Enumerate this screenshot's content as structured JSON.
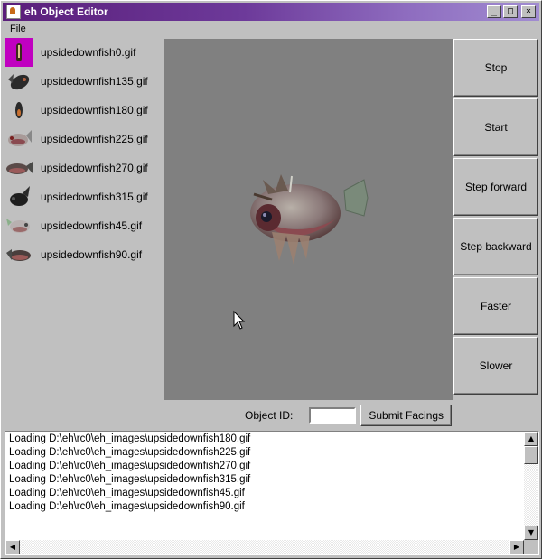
{
  "window": {
    "title": "eh Object Editor",
    "controls": {
      "minimize": "_",
      "maximize": "□",
      "close": "×"
    }
  },
  "menu": {
    "file": "File"
  },
  "files": [
    {
      "name": "upsidedownfish0.gif",
      "selected": true
    },
    {
      "name": "upsidedownfish135.gif",
      "selected": false
    },
    {
      "name": "upsidedownfish180.gif",
      "selected": false
    },
    {
      "name": "upsidedownfish225.gif",
      "selected": false
    },
    {
      "name": "upsidedownfish270.gif",
      "selected": false
    },
    {
      "name": "upsidedownfish315.gif",
      "selected": false
    },
    {
      "name": "upsidedownfish45.gif",
      "selected": false
    },
    {
      "name": "upsidedownfish90.gif",
      "selected": false
    }
  ],
  "controls": {
    "stop": "Stop",
    "start": "Start",
    "step_forward": "Step forward",
    "step_backward": "Step backward",
    "faster": "Faster",
    "slower": "Slower"
  },
  "object_id": {
    "label": "Object ID:",
    "value": "",
    "submit": "Submit Facings"
  },
  "log": [
    "Loading D:\\eh\\rc0\\eh_images\\upsidedownfish180.gif",
    "Loading D:\\eh\\rc0\\eh_images\\upsidedownfish225.gif",
    "Loading D:\\eh\\rc0\\eh_images\\upsidedownfish270.gif",
    "Loading D:\\eh\\rc0\\eh_images\\upsidedownfish315.gif",
    "Loading D:\\eh\\rc0\\eh_images\\upsidedownfish45.gif",
    "Loading D:\\eh\\rc0\\eh_images\\upsidedownfish90.gif"
  ],
  "colors": {
    "selection": "#c000c0",
    "canvas": "#808080",
    "titlebar_start": "#5a1e7a",
    "titlebar_end": "#a18cd1"
  }
}
